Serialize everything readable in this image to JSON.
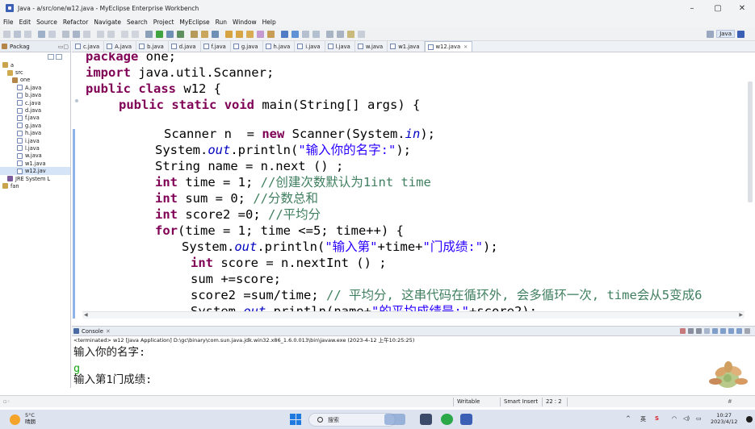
{
  "window": {
    "title": "Java - a/src/one/w12.java - MyEclipse Enterprise Workbench",
    "controls": {
      "minimize": "–",
      "maximize": "▢",
      "close": "✕"
    }
  },
  "menu": [
    "File",
    "Edit",
    "Source",
    "Refactor",
    "Navigate",
    "Search",
    "Project",
    "MyEclipse",
    "Run",
    "Window",
    "Help"
  ],
  "perspective": {
    "java_label": "Java"
  },
  "package_explorer": {
    "title": "Packag",
    "tree": [
      {
        "label": "a",
        "icon": "project-icon"
      },
      {
        "label": "src",
        "icon": "source-folder-icon"
      },
      {
        "label": "one",
        "icon": "package-icon"
      },
      {
        "label": "A.java",
        "icon": "java-file-icon"
      },
      {
        "label": "b.java",
        "icon": "java-file-icon"
      },
      {
        "label": "c.java",
        "icon": "java-file-icon"
      },
      {
        "label": "d.java",
        "icon": "java-file-icon"
      },
      {
        "label": "f.java",
        "icon": "java-file-icon"
      },
      {
        "label": "g.java",
        "icon": "java-file-icon"
      },
      {
        "label": "h.java",
        "icon": "java-file-icon"
      },
      {
        "label": "i.java",
        "icon": "java-file-icon"
      },
      {
        "label": "l.java",
        "icon": "java-file-icon"
      },
      {
        "label": "w.java",
        "icon": "java-file-icon"
      },
      {
        "label": "w1.java",
        "icon": "java-file-icon"
      },
      {
        "label": "w12.jav",
        "icon": "java-file-icon"
      },
      {
        "label": "JRE System L",
        "icon": "library-icon"
      },
      {
        "label": "fan",
        "icon": "project-icon"
      }
    ]
  },
  "editor_tabs": [
    "c.java",
    "A.java",
    "b.java",
    "d.java",
    "f.java",
    "g.java",
    "h.java",
    "i.java",
    "l.java",
    "w.java",
    "w1.java",
    "w12.java"
  ],
  "code": {
    "l0": [
      "package",
      " one;"
    ],
    "l1": [
      "import",
      " java.util.Scanner;"
    ],
    "l2": [
      "public",
      " ",
      "class",
      " w12 {"
    ],
    "l3": [
      "public",
      " ",
      "static",
      " ",
      "void",
      " main(String[] args) {"
    ],
    "l4": [
      "Scanner n  = ",
      "new",
      " Scanner(System.",
      "in",
      ");"
    ],
    "l5": [
      "System.",
      "out",
      ".println(",
      "\"输入你的名字:\"",
      ");"
    ],
    "l6": [
      "String name = n.next () ;"
    ],
    "l7": [
      "int",
      " time = 1; ",
      "//创建次数默认为1int time"
    ],
    "l8": [
      "int",
      " sum = 0; ",
      "//分数总和"
    ],
    "l9": [
      "int",
      " score2 =0; ",
      "//平均分"
    ],
    "l10": [
      "for",
      "(time = 1; time <=5; time++) {"
    ],
    "l11": [
      "System.",
      "out",
      ".println(",
      "\"输入第\"",
      "+time+",
      "\"门成绩:\"",
      ");"
    ],
    "l12": [
      "int",
      " score = n.nextInt () ;"
    ],
    "l13": [
      "sum +=score;"
    ],
    "l14": [
      "score2 =sum/time; ",
      "// 平均分, 这串代码在循环外, 会多循环一次, time会从5变成6"
    ],
    "l15": [
      "System.",
      "out",
      ".println(name+",
      "\"的平均成绩是:\"",
      "+score2);"
    ]
  },
  "console": {
    "title": "Console",
    "terminated": "<terminated> w12 [Java Application] D:\\gc\\binary\\com.sun.java.jdk.win32.x86_1.6.0.013\\bin\\javaw.exe (2023-4-12 上午10:25:25)",
    "lines": [
      "输入你的名字:",
      "g",
      "输入第1门成绩:"
    ]
  },
  "status_bar": {
    "writable": "Writable",
    "insert_mode": "Smart Insert",
    "position": "22 : 2"
  },
  "taskbar": {
    "temperature": "5°C",
    "weather": "晴朗",
    "search_placeholder": "搜索",
    "ime_label": "英",
    "time": "10:27",
    "date": "2023/4/12"
  }
}
